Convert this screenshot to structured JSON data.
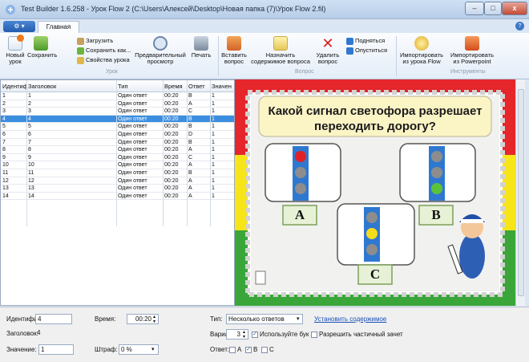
{
  "window": {
    "title": "Test Builder 1.6.258 - Урок Flow 2 (C:\\Users\\Алексей\\Desktop\\Новая папка (7)\\Урок Flow 2.fil)",
    "min": "–",
    "max": "□",
    "close": "x"
  },
  "ribbon": {
    "app_button": "⚙ ▾",
    "tab_main": "Главная",
    "help": "?",
    "new_lesson": "Новый урок",
    "save": "Сохранить",
    "load": "Загрузить",
    "save_as": "Сохранить как...",
    "lesson_props": "Свойства урока",
    "preview": "Предварительный просмотр",
    "print": "Печать",
    "group_lesson": "Урок",
    "insert_question": "Вставить вопрос",
    "assign_content": "Назначить содержимое вопроса",
    "delete_question": "Удалить вопрос",
    "move_up": "Подняться",
    "move_down": "Опуститься",
    "group_question": "Вопрос",
    "import_flow": "Импортировать из урока Flow",
    "import_ppt": "Импортировать из Powerpoint",
    "group_tools": "Инструменты"
  },
  "grid": {
    "headers": [
      "Идентиф",
      "Заголовок",
      "Тип",
      "Время",
      "Ответ",
      "Значен"
    ],
    "rows": [
      [
        "1",
        "1",
        "Один ответ",
        "00:20",
        "B",
        "1"
      ],
      [
        "2",
        "2",
        "Один ответ",
        "00:20",
        "A",
        "1"
      ],
      [
        "3",
        "3",
        "Один ответ",
        "00:20",
        "C",
        "1"
      ],
      [
        "4",
        "4",
        "Один ответ",
        "00:20",
        "B",
        "1"
      ],
      [
        "5",
        "5",
        "Один ответ",
        "00:20",
        "B",
        "1"
      ],
      [
        "6",
        "6",
        "Один ответ",
        "00:20",
        "D",
        "1"
      ],
      [
        "7",
        "7",
        "Один ответ",
        "00:20",
        "B",
        "1"
      ],
      [
        "8",
        "8",
        "Один ответ",
        "00:20",
        "A",
        "1"
      ],
      [
        "9",
        "9",
        "Один ответ",
        "00:20",
        "C",
        "1"
      ],
      [
        "10",
        "10",
        "Один ответ",
        "00:20",
        "A",
        "1"
      ],
      [
        "11",
        "11",
        "Один ответ",
        "00:20",
        "B",
        "1"
      ],
      [
        "12",
        "12",
        "Один ответ",
        "00:20",
        "A",
        "1"
      ],
      [
        "13",
        "13",
        "Один ответ",
        "00:20",
        "A",
        "1"
      ],
      [
        "14",
        "14",
        "Один ответ",
        "00:20",
        "A",
        "1"
      ]
    ],
    "selected_index": 3
  },
  "slide": {
    "question": "Какой сигнал светофора разрешает переходить дорогу?",
    "label_a": "A",
    "label_b": "B",
    "label_c": "C"
  },
  "form": {
    "id_label": "Идентифик",
    "id_value": "4",
    "time_label": "Время:",
    "time_value": "00:20",
    "title_label": "Заголовок:",
    "title_value": "4",
    "value_label": "Значение:",
    "value_value": "1",
    "penalty_label": "Штраф:",
    "penalty_value": "0 %",
    "type_label": "Тип:",
    "type_value": "Несколько ответов",
    "set_content_link": "Установить содержимое",
    "variants_label": "Варианты:",
    "variants_value": "3",
    "use_letters": "Используйте бук",
    "partial_credit": "Разрешить частичный зачет",
    "answer_label": "Ответ:",
    "answers": [
      "A",
      "B",
      "C"
    ],
    "answers_checked": [
      false,
      true,
      false
    ]
  },
  "colors": {
    "red": "#e5262b",
    "yellow": "#f7e51a",
    "green": "#3aa639",
    "selection": "#3b8ee0"
  }
}
